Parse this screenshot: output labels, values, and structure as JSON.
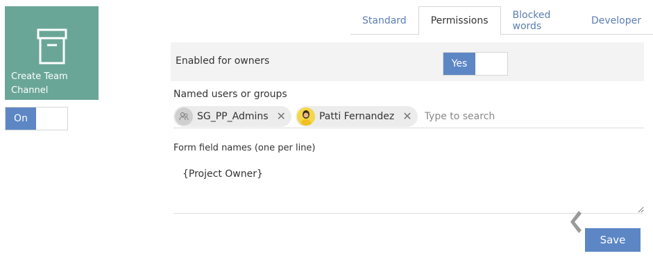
{
  "tile": {
    "label": "Create Team Channel",
    "icon": "archive-box-icon",
    "color": "#6aa697"
  },
  "tile_toggle": {
    "on_label": "On"
  },
  "tabs": [
    {
      "label": "Standard",
      "active": false
    },
    {
      "label": "Permissions",
      "active": true
    },
    {
      "label": "Blocked words",
      "active": false
    },
    {
      "label": "Developer",
      "active": false
    }
  ],
  "owners": {
    "label": "Enabled for owners",
    "toggle_label": "Yes"
  },
  "named": {
    "label": "Named users or groups",
    "chips": [
      {
        "name": "SG_PP_Admins",
        "icon": "group-icon"
      },
      {
        "name": "Patti Fernandez",
        "icon": "person-avatar"
      }
    ],
    "placeholder": "Type to search"
  },
  "form_fields": {
    "label": "Form field names (one per line)",
    "value": "{Project Owner}"
  },
  "save_label": "Save",
  "accent": "#5d86c5"
}
